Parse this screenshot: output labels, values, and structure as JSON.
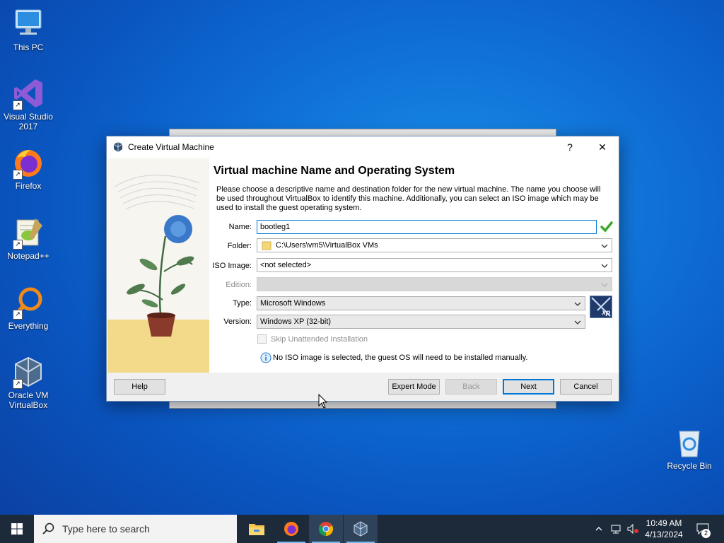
{
  "desktop": {
    "icons": [
      {
        "label": "This PC",
        "icon": "computer-icon"
      },
      {
        "label": "Visual Studio 2017",
        "icon": "visual-studio-icon"
      },
      {
        "label": "Firefox",
        "icon": "firefox-icon"
      },
      {
        "label": "Notepad++",
        "icon": "notepad-plus-plus-icon"
      },
      {
        "label": "Everything",
        "icon": "everything-search-icon"
      },
      {
        "label": "Oracle VM VirtualBox",
        "icon": "virtualbox-icon"
      },
      {
        "label": "Recycle Bin",
        "icon": "recycle-bin-icon"
      }
    ]
  },
  "dialog": {
    "title": "Create Virtual Machine",
    "help_glyph": "?",
    "close_glyph": "✕",
    "heading": "Virtual machine Name and Operating System",
    "description": "Please choose a descriptive name and destination folder for the new virtual machine. The name you choose will be used throughout VirtualBox to identify this machine. Additionally, you can select an ISO image which may be used to install the guest operating system.",
    "fields": {
      "name_label": "Name:",
      "name_value": "bootleg1",
      "folder_label": "Folder:",
      "folder_value": "C:\\Users\\vm5\\VirtualBox VMs",
      "iso_label": "ISO Image:",
      "iso_value": "<not selected>",
      "edition_label": "Edition:",
      "edition_value": "",
      "type_label": "Type:",
      "type_value": "Microsoft Windows",
      "version_label": "Version:",
      "version_value": "Windows XP (32-bit)",
      "os_badge": "xp"
    },
    "skip_unattended_label": "Skip Unattended Installation",
    "info_message": "No ISO image is selected, the guest OS will need to be installed manually.",
    "buttons": {
      "help": "Help",
      "expert_mode": "Expert Mode",
      "back": "Back",
      "next": "Next",
      "cancel": "Cancel"
    }
  },
  "taskbar": {
    "search_placeholder": "Type here to search",
    "apps": [
      "file-explorer-icon",
      "firefox-icon",
      "chrome-icon",
      "virtualbox-icon"
    ],
    "time": "10:49 AM",
    "date": "4/13/2024",
    "notification_count": "2"
  },
  "colors": {
    "accent": "#0078d7",
    "taskbar": "#1c2a3a",
    "desktop": "#0f6fd6"
  }
}
